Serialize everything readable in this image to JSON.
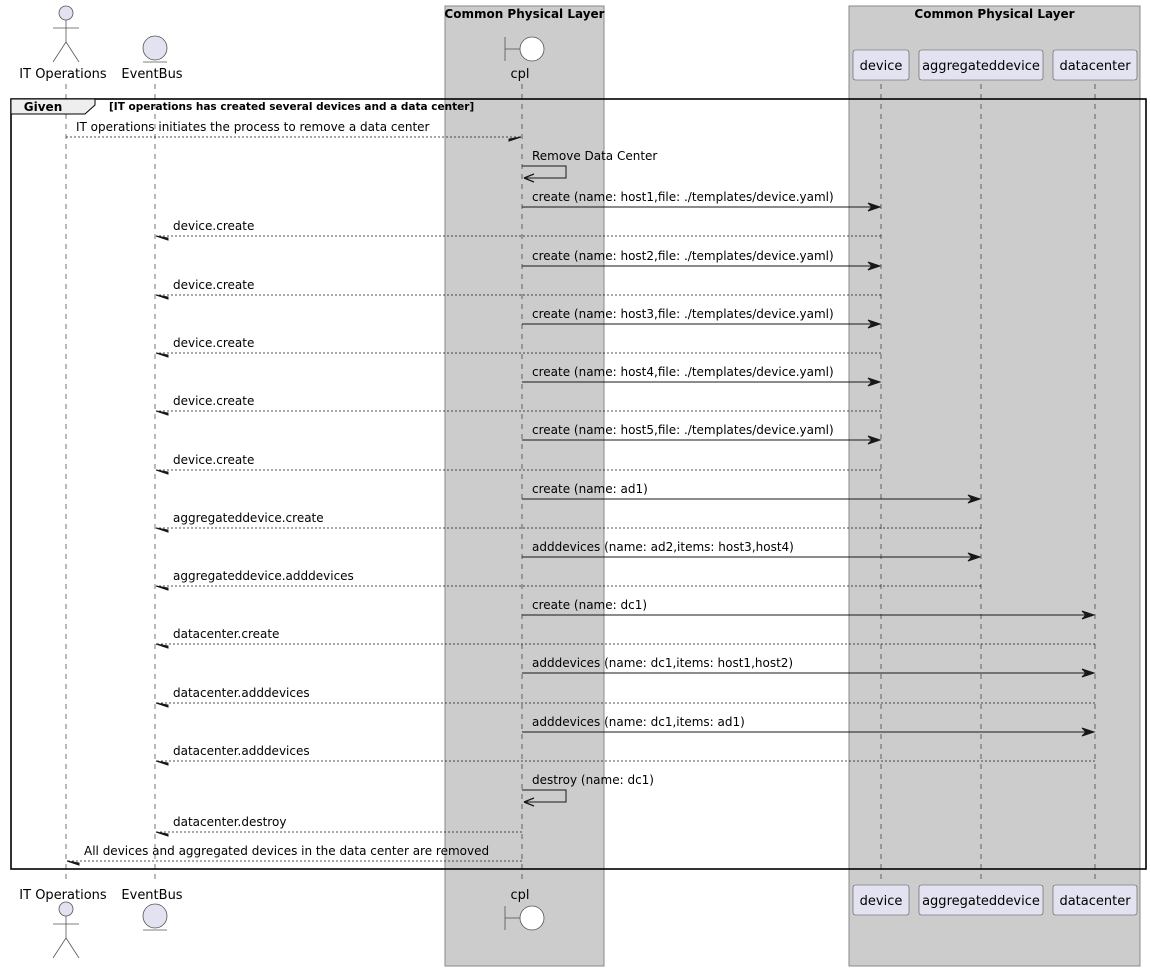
{
  "diagram": {
    "type": "sequence",
    "boxes": [
      {
        "title": "Common Physical Layer",
        "participants": [
          "cpl"
        ]
      },
      {
        "title": "Common Physical Layer",
        "participants": [
          "device",
          "aggregateddevice",
          "datacenter"
        ]
      }
    ],
    "participants": [
      {
        "id": "itops",
        "label": "IT Operations",
        "kind": "actor"
      },
      {
        "id": "eventbus",
        "label": "EventBus",
        "kind": "entity"
      },
      {
        "id": "cpl",
        "label": "cpl",
        "kind": "boundary"
      },
      {
        "id": "device",
        "label": "device",
        "kind": "participant"
      },
      {
        "id": "aggregateddevice",
        "label": "aggregateddevice",
        "kind": "participant"
      },
      {
        "id": "datacenter",
        "label": "datacenter",
        "kind": "participant"
      }
    ],
    "group": {
      "keyword": "Given",
      "condition": "[IT operations has created several devices and a data center]"
    },
    "messages": [
      {
        "from": "itops",
        "to": "cpl",
        "text": "IT operations initiates the process to remove a data center",
        "style": "async-dashed"
      },
      {
        "from": "cpl",
        "to": "cpl",
        "text": "Remove Data Center",
        "style": "self"
      },
      {
        "from": "cpl",
        "to": "device",
        "text": "create (name: host1,file: ./templates/device.yaml)",
        "style": "solid"
      },
      {
        "from": "device",
        "to": "eventbus",
        "text": "device.create",
        "style": "async-dashed"
      },
      {
        "from": "cpl",
        "to": "device",
        "text": "create (name: host2,file: ./templates/device.yaml)",
        "style": "solid"
      },
      {
        "from": "device",
        "to": "eventbus",
        "text": "device.create",
        "style": "async-dashed"
      },
      {
        "from": "cpl",
        "to": "device",
        "text": "create (name: host3,file: ./templates/device.yaml)",
        "style": "solid"
      },
      {
        "from": "device",
        "to": "eventbus",
        "text": "device.create",
        "style": "async-dashed"
      },
      {
        "from": "cpl",
        "to": "device",
        "text": "create (name: host4,file: ./templates/device.yaml)",
        "style": "solid"
      },
      {
        "from": "device",
        "to": "eventbus",
        "text": "device.create",
        "style": "async-dashed"
      },
      {
        "from": "cpl",
        "to": "device",
        "text": "create (name: host5,file: ./templates/device.yaml)",
        "style": "solid"
      },
      {
        "from": "device",
        "to": "eventbus",
        "text": "device.create",
        "style": "async-dashed"
      },
      {
        "from": "cpl",
        "to": "aggregateddevice",
        "text": "create (name: ad1)",
        "style": "solid"
      },
      {
        "from": "aggregateddevice",
        "to": "eventbus",
        "text": "aggregateddevice.create",
        "style": "async-dashed"
      },
      {
        "from": "cpl",
        "to": "aggregateddevice",
        "text": "adddevices (name: ad2,items: host3,host4)",
        "style": "solid"
      },
      {
        "from": "aggregateddevice",
        "to": "eventbus",
        "text": "aggregateddevice.adddevices",
        "style": "async-dashed"
      },
      {
        "from": "cpl",
        "to": "datacenter",
        "text": "create (name: dc1)",
        "style": "solid"
      },
      {
        "from": "datacenter",
        "to": "eventbus",
        "text": "datacenter.create",
        "style": "async-dashed"
      },
      {
        "from": "cpl",
        "to": "datacenter",
        "text": "adddevices (name: dc1,items: host1,host2)",
        "style": "solid"
      },
      {
        "from": "datacenter",
        "to": "eventbus",
        "text": "datacenter.adddevices",
        "style": "async-dashed"
      },
      {
        "from": "cpl",
        "to": "datacenter",
        "text": "adddevices (name: dc1,items: ad1)",
        "style": "solid"
      },
      {
        "from": "datacenter",
        "to": "eventbus",
        "text": "datacenter.adddevices",
        "style": "async-dashed"
      },
      {
        "from": "cpl",
        "to": "cpl",
        "text": "destroy (name: dc1)",
        "style": "self"
      },
      {
        "from": "cpl",
        "to": "eventbus",
        "text": "datacenter.destroy",
        "style": "async-dashed"
      },
      {
        "from": "cpl",
        "to": "itops",
        "text": "All devices and aggregated devices in the data center are removed",
        "style": "async-dashed"
      }
    ],
    "colors": {
      "box_fill": "#cccccc",
      "box_border": "#888888",
      "participant_fill": "#e2e2f0",
      "participant_border": "#181818",
      "line": "#181818"
    }
  }
}
